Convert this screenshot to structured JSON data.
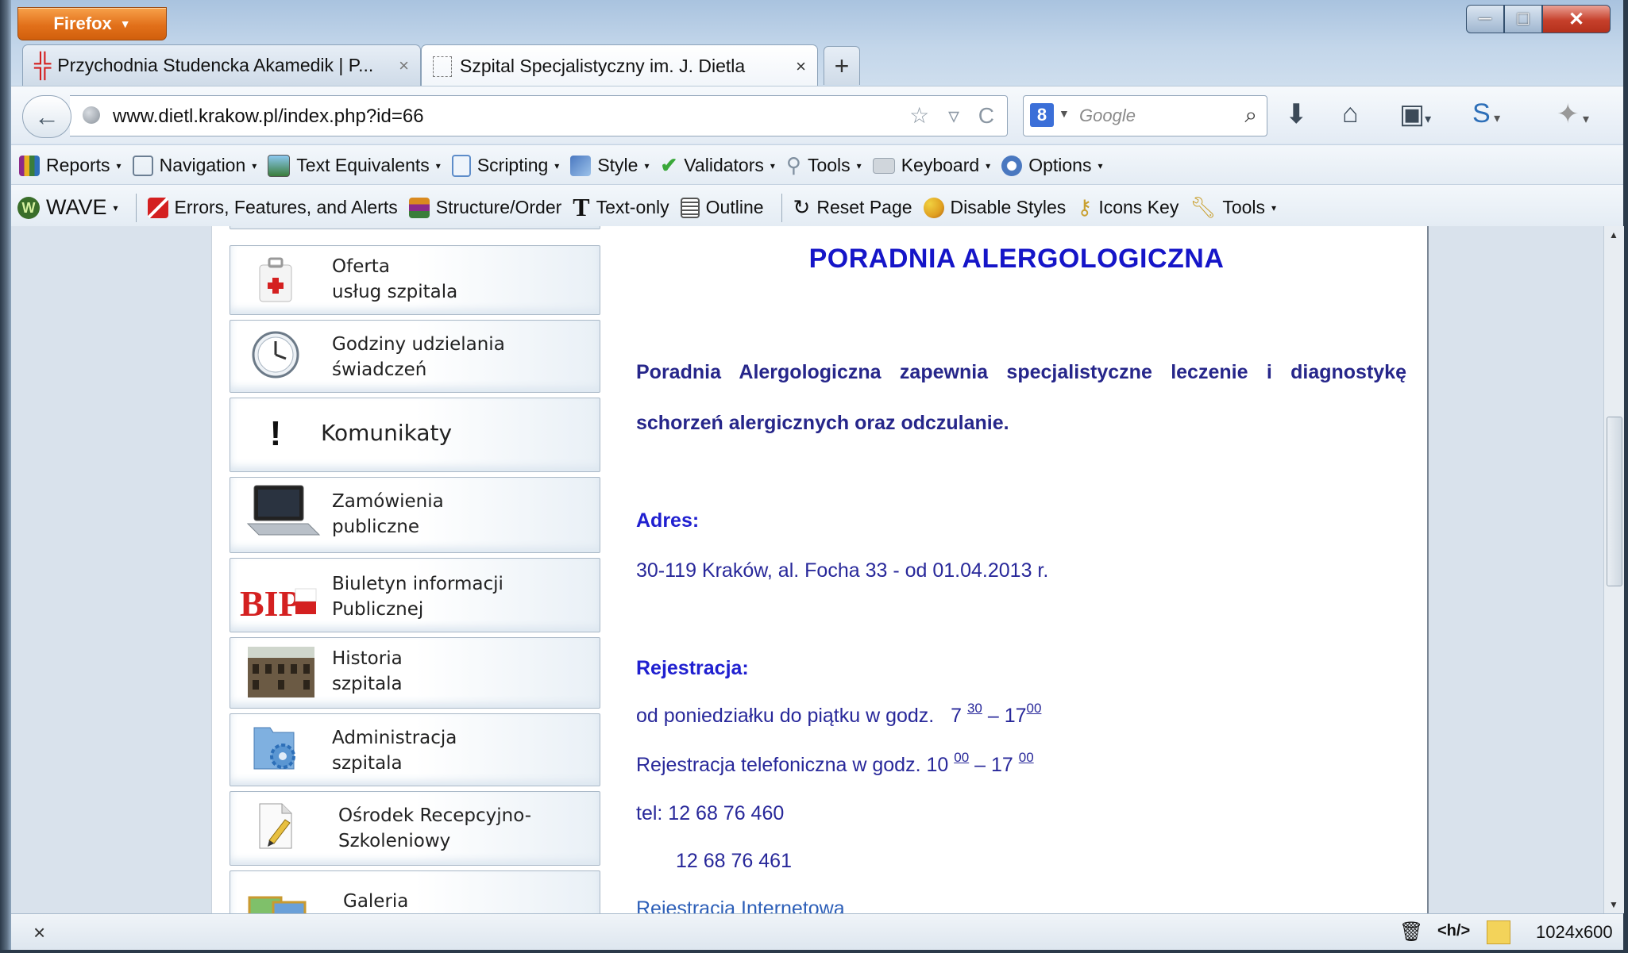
{
  "window": {
    "firefox_label": "Firefox",
    "min_glyph": "—",
    "max_glyph": "□",
    "close_glyph": "✕"
  },
  "tabs": [
    {
      "title": "Przychodnia Studencka Akamedik | P...",
      "active": false
    },
    {
      "title": "Szpital Specjalistyczny im. J. Dietla",
      "active": true
    }
  ],
  "newtab_label": "+",
  "tab_close_glyph": "×",
  "navbar": {
    "url": "www.dietl.krakow.pl/index.php?id=66",
    "search_engine": "8",
    "search_placeholder": "Google",
    "search_icon": "⌕",
    "url_icons": "☆ ▿ C",
    "icons": [
      "download-icon",
      "home-icon",
      "bookmarks-icon",
      "sync-icon",
      "addon-icon"
    ]
  },
  "toolbar1": [
    {
      "label": "Reports",
      "icon": "reports-icon",
      "color": "#8b2a8b"
    },
    {
      "label": "Navigation",
      "icon": "navigation-icon",
      "color": "#6b7e93"
    },
    {
      "label": "Text Equivalents",
      "icon": "text-equivalents-icon",
      "color": "#3a7d3a"
    },
    {
      "label": "Scripting",
      "icon": "scripting-icon",
      "color": "#5d8cc9"
    },
    {
      "label": "Style",
      "icon": "style-icon",
      "color": "#4a78c0"
    },
    {
      "label": "Validators",
      "icon": "validators-icon",
      "color": "#3aa83a"
    },
    {
      "label": "Tools",
      "icon": "tools-icon",
      "color": "#8090a0"
    },
    {
      "label": "Keyboard",
      "icon": "keyboard-icon",
      "color": "#9aa5b0"
    },
    {
      "label": "Options",
      "icon": "options-icon",
      "color": "#4a78c0"
    }
  ],
  "toolbar2": {
    "wave_label": "WAVE",
    "items": [
      {
        "label": "Errors, Features, and Alerts",
        "icon": "errors-icon",
        "color": "#d42020"
      },
      {
        "label": "Structure/Order",
        "icon": "structure-icon",
        "color": "#d98a20"
      },
      {
        "label": "Text-only",
        "icon": "text-only-icon",
        "color": "#111111"
      },
      {
        "label": "Outline",
        "icon": "outline-icon",
        "color": "#555555"
      },
      {
        "label": "Reset Page",
        "icon": "reset-icon",
        "color": "#444444"
      },
      {
        "label": "Disable Styles",
        "icon": "disable-styles-icon",
        "color": "#e0a020"
      },
      {
        "label": "Icons Key",
        "icon": "icons-key-icon",
        "color": "#c9a030"
      },
      {
        "label": "Tools",
        "icon": "tools-icon",
        "color": "#c9a030"
      }
    ]
  },
  "menu": [
    {
      "line1": "Oferta",
      "line2": "usług szpitala",
      "icon": "medical-kit-icon"
    },
    {
      "line1": "Godziny udzielania",
      "line2": "świadczeń",
      "icon": "clock-icon"
    },
    {
      "line1": "Komunikaty",
      "line2": "",
      "icon": "exclamation-icon"
    },
    {
      "line1": "Zamówienia",
      "line2": "publiczne",
      "icon": "laptop-icon"
    },
    {
      "line1": "Biuletyn informacji",
      "line2": "Publicznej",
      "icon": "bip-logo-icon"
    },
    {
      "line1": "Historia",
      "line2": "szpitala",
      "icon": "building-photo-icon"
    },
    {
      "line1": "Administracja",
      "line2": "szpitala",
      "icon": "folder-gear-icon"
    },
    {
      "line1": "Ośrodek Recepcyjno-",
      "line2": "Szkoleniowy",
      "icon": "document-pen-icon"
    },
    {
      "line1": "Galeria",
      "line2": "",
      "icon": "gallery-icon"
    }
  ],
  "main": {
    "heading": "PORADNIA ALERGOLOGICZNA",
    "description": "Poradnia Alergologiczna zapewnia specjalistyczne leczenie i diagnostykę schorzeń alergicznych oraz odczulanie.",
    "address_label": "Adres:",
    "address": "30-119 Kraków, al. Focha 33 - od 01.04.2013 r.",
    "registration_label": "Rejestracja:",
    "reg_hours_text": "od poniedziałku do piątku w godz.",
    "reg_hours_from": "7",
    "reg_hours_from_min": "30",
    "reg_hours_dash": "–",
    "reg_hours_to": "17",
    "reg_hours_to_min": "00",
    "phone_reg_text": "Rejestracja telefoniczna  w godz.",
    "phone_from": "10",
    "phone_from_min": "00",
    "phone_dash": "–",
    "phone_to": "17",
    "phone_to_min": "00",
    "tel1": "tel: 12 68 76 460",
    "tel2": "12 68 76 461",
    "internet_reg": "Rejestracja Internetowa"
  },
  "statusbar": {
    "close_glyph": "×",
    "html_tag": "<h/>",
    "resolution": "1024x600"
  }
}
